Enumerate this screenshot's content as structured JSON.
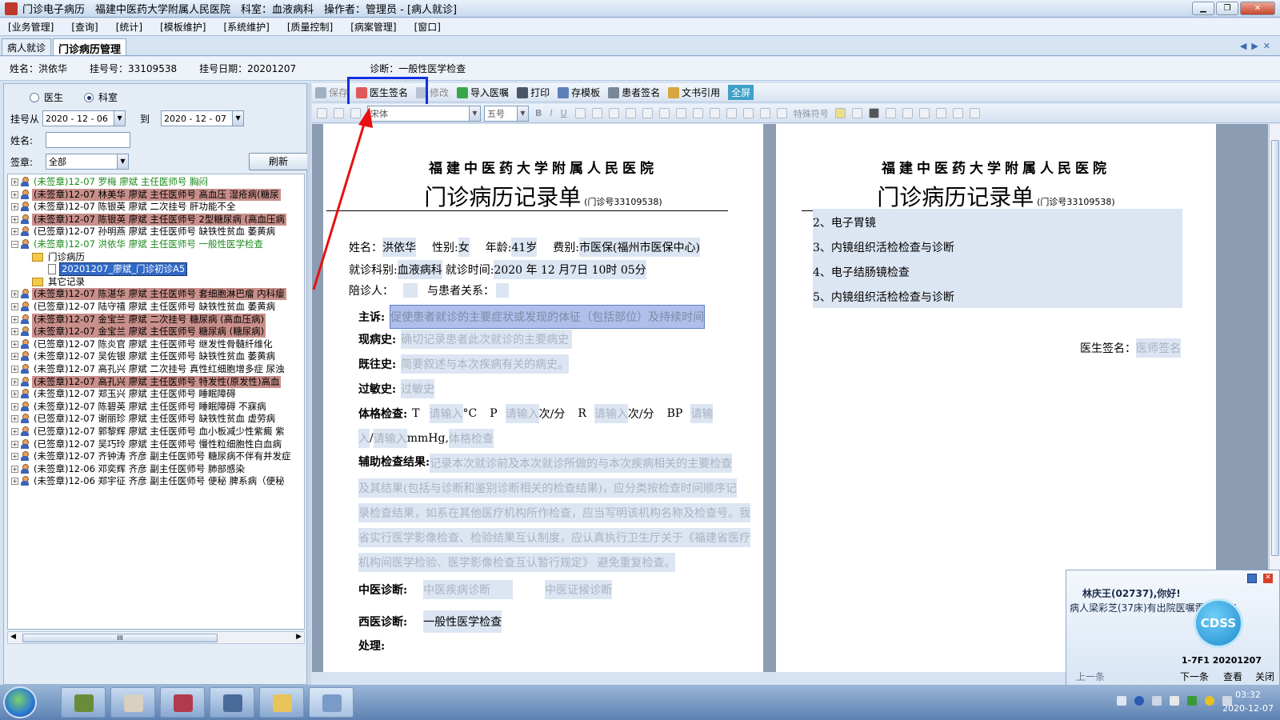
{
  "window": {
    "title": "门诊电子病历　福建中医药大学附属人民医院　科室：血液病科　操作者：管理员 - [病人就诊]"
  },
  "menu": [
    "[业务管理]",
    "[查询]",
    "[统计]",
    "[模板维护]",
    "[系统维护]",
    "[质量控制]",
    "[病案管理]",
    "[窗口]"
  ],
  "tabs": [
    "病人就诊",
    "门诊病历管理"
  ],
  "patient_bar": {
    "name": "姓名：洪依华",
    "reg_no": "挂号号：33109538",
    "reg_date": "挂号日期：20201207",
    "diagnosis": "诊断：一般性医学检查"
  },
  "filter": {
    "radio_doctor": "医生",
    "radio_dept": "科室",
    "date_from_label": "挂号从",
    "date_from": "2020 - 12 - 06",
    "to_label": "到",
    "date_to": "2020 - 12 - 07",
    "name_label": "姓名:",
    "sign_label": "签章:",
    "sign_value": "全部",
    "refresh": "刷新"
  },
  "tree": [
    {
      "text": "(未签章)12-07  罗梅  廖斌  主任医师号  胸闷",
      "green": true,
      "hl": false
    },
    {
      "text": "(未签章)12-07  林美华  廖斌  主任医师号  高血压  湿疮病(糖尿",
      "green": false,
      "hl": true
    },
    {
      "text": "(未签章)12-07  陈银英  廖斌  二次挂号  肝功能不全",
      "green": false,
      "hl": false
    },
    {
      "text": "(未签章)12-07  陈银英  廖斌  主任医师号  2型糖尿病  (高血压病",
      "green": false,
      "hl": true
    },
    {
      "text": "(已签章)12-07  孙明燕  廖斌  主任医师号  缺铁性贫血  萎黄病",
      "green": false,
      "hl": false
    },
    {
      "text": "(未签章)12-07  洪依华  廖斌  主任医师号  一般性医学检查",
      "green": true,
      "hl": false,
      "expanded": true
    },
    {
      "text": "门诊病历",
      "level": 1,
      "folder": true
    },
    {
      "text": "20201207_廖斌_门诊初诊A5",
      "level": 2,
      "doc": true
    },
    {
      "text": "其它记录",
      "level": 1,
      "folder": true
    },
    {
      "text": "(未签章)12-07  陈湛华  廖斌  主任医师号  套细胞淋巴瘤  内科瘿",
      "green": false,
      "hl": true
    },
    {
      "text": "(已签章)12-07  陆守禧  廖斌  主任医师号  缺铁性贫血  萎黄病",
      "green": false,
      "hl": false
    },
    {
      "text": "(未签章)12-07  金宝兰  廖斌  二次挂号  糖尿病  (高血压病)",
      "green": false,
      "hl": true
    },
    {
      "text": "(未签章)12-07  金宝兰  廖斌  主任医师号  糖尿病  (糖尿病)",
      "green": false,
      "hl": true
    },
    {
      "text": "(已签章)12-07  陈炎官  廖斌  主任医师号  继发性骨髓纤维化",
      "green": false,
      "hl": false
    },
    {
      "text": "(未签章)12-07  吴佐银  廖斌  主任医师号  缺铁性贫血  萎黄病",
      "green": false,
      "hl": false
    },
    {
      "text": "(未签章)12-07  高孔兴  廖斌  二次挂号  真性红细胞增多症  尿浊",
      "green": false,
      "hl": false
    },
    {
      "text": "(未签章)12-07  高孔兴  廖斌  主任医师号  特发性(原发性)高血",
      "green": false,
      "hl": true
    },
    {
      "text": "(未签章)12-07  郑玉兴  廖斌  主任医师号  睡眠障碍",
      "green": false,
      "hl": false
    },
    {
      "text": "(未签章)12-07  陈碧英  廖斌  主任医师号  睡眠障碍  不寐病",
      "green": false,
      "hl": false
    },
    {
      "text": "(已签章)12-07  谢丽珍  廖斌  主任医师号  缺铁性贫血  虚劳病",
      "green": false,
      "hl": false
    },
    {
      "text": "(已签章)12-07  郭黎辉  廖斌  主任医师号  血小板减少性紫癜  紫",
      "green": false,
      "hl": false
    },
    {
      "text": "(已签章)12-07  吴巧玲  廖斌  主任医师号  慢性粒细胞性白血病",
      "green": false,
      "hl": false
    },
    {
      "text": "(未签章)12-07  齐钟涛  齐彦  副主任医师号  糖尿病不伴有并发症",
      "green": false,
      "hl": false
    },
    {
      "text": "(未签章)12-06  邓奕辉  齐彦  副主任医师号  肺部感染",
      "green": false,
      "hl": false
    },
    {
      "text": "(未签章)12-06  郑宇征  齐彦  副主任医师号  便秘  脾系病（便秘",
      "green": false,
      "hl": false
    }
  ],
  "toolbar": {
    "save": "保存",
    "doctor_sign": "医生签名",
    "modify": "修改",
    "import_order": "导入医嘱",
    "print": "打印",
    "save_template": "存模板",
    "patient_sign": "患者签名",
    "doc_ref": "文书引用",
    "fullscreen": "全屏"
  },
  "format_bar": {
    "font": "宋体",
    "size": "五号",
    "special": "特殊符号"
  },
  "page1": {
    "hospital": "福建中医药大学附属人民医院",
    "title": "门诊病历记录单",
    "title_no": "(门诊号33109538)",
    "name_label": "姓名：",
    "name": "洪依华",
    "sex_label": "性别:",
    "sex": "女",
    "age_label": "年龄:",
    "age": "41岁",
    "fee_label": "费别:",
    "fee": "市医保(福州市医保中心)",
    "dept_label": "就诊科别:",
    "dept": "血液病科",
    "visit_label": "就诊时间:",
    "visit": "2020 年 12 月7日 10时 05分",
    "companion_label": "陪诊人：",
    "relation_label": "与患者关系：",
    "chief_label": "主诉:",
    "chief_ph": "促使患者就诊的主要症状或发现的体征（包括部位）及持续时间",
    "present_label": "现病史:",
    "present_ph": "确切记录患者此次就诊的主要病史",
    "past_label": "既往史:",
    "past_ph": "简要叙述与本次疾病有关的病史。",
    "allergy_label": "过敏史:",
    "allergy_ph": "过敏史",
    "exam_label": "体格检查:",
    "exam_t": "T",
    "exam_ph1": "请输入",
    "exam_unit1": "°C",
    "exam_p": "P",
    "exam_ph2": "请输入",
    "exam_unit2": "次/分",
    "exam_r": "R",
    "exam_ph3": "请输入",
    "exam_unit3": "次/分",
    "exam_bp": "BP",
    "exam_ph4": "请输",
    "exam_ph5": "入",
    "exam_slash": "/",
    "exam_ph6": "请输入",
    "exam_unit4": "mmHg,",
    "exam_ph7": "体格检查",
    "aux_label": "辅助检查结果:",
    "aux_lines": [
      "记录本次就诊前及本次就诊所做的与本次疾病相关的主要检查",
      "及其结果(包括与诊断和鉴别诊断相关的检查结果)，应分类按检查时间顺序记",
      "录检查结果，如系在其他医疗机构所作检查，应当写明该机构名称及检查号。我",
      "省实行医学影像检查、检验结果互认制度，应认真执行卫生厅关于《福建省医疗",
      "机构间医学检验、医学影像检查互认暂行规定》 避免重复检查。"
    ],
    "tcm_label": "中医诊断:",
    "tcm_ph1": "中医疾病诊断",
    "tcm_ph2": "中医证候诊断",
    "wm_label": "西医诊断:",
    "wm": "一般性医学检查",
    "treat_label": "处理:"
  },
  "page2": {
    "hospital": "福建中医药大学附属人民医院",
    "title": "门诊病历记录单",
    "title_no": "(门诊号33109538)",
    "items": [
      "2、电子胃镜",
      "3、内镜组织活检检查与诊断",
      "4、电子结肠镜检查",
      "5、内镜组织活检检查与诊断"
    ],
    "sign_label": "医生签名：",
    "sign_ph": "医师签名"
  },
  "notify": {
    "greeting": "林庆王(02737),你好!",
    "message": "病人梁彩芝(37床)有出院医嘱需要处理!",
    "logo": "CDSS",
    "footer": "1-7F1  20201207",
    "prev": "上一条",
    "next": "下一条",
    "view": "查看",
    "close": "关闭"
  },
  "clock": {
    "time": "03:32",
    "date": "2020-12-07"
  }
}
